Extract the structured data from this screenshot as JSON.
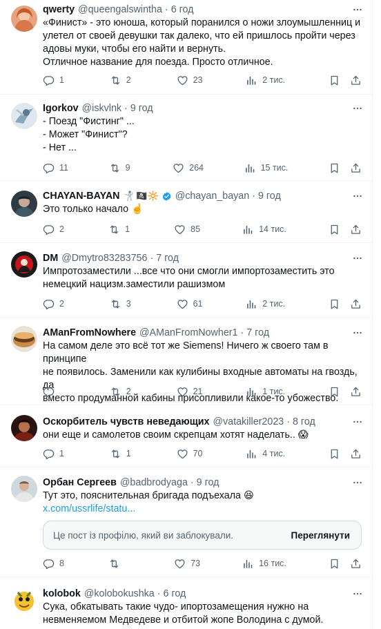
{
  "posts": [
    {
      "name": "qwerty",
      "handle": "@queengalswintha",
      "time": "6 год",
      "text": "«Финист» - это юноша, который поранился о ножи злоумышленниц и\nулетел от своей девушки так далеко, что ей пришлось пройти через\nадовы муки, чтобы его найти и вернуть.\nОтличное название для поезда. Просто отличное.",
      "replies": "1",
      "reposts": "2",
      "likes": "23",
      "views": "2 тис."
    },
    {
      "name": "Igorkov",
      "handle": "@iskvlnk",
      "time": "9 год",
      "text": "- Поезд \"Фистинг\" ...\n- Может \"Финист\"?\n- Нет ...",
      "replies": "11",
      "reposts": "9",
      "likes": "264",
      "views": "15 тис."
    },
    {
      "name": "CHAYAN-BAYAN",
      "badges": "🤺 🏴‍☠️🔆",
      "handle": "@chayan_bayan",
      "time": "9 год",
      "text": "Это только начало ☝️",
      "replies": "2",
      "reposts": "1",
      "likes": "85",
      "views": "14 тис."
    },
    {
      "name": "DM",
      "handle": "@Dmytro83283756",
      "time": "7 год",
      "text": "Импротозаместили ...все что они смогли импортозаместить это\nнемецкий нацизм.заместили рашизмом",
      "replies": "2",
      "reposts": "3",
      "likes": "61",
      "views": "2 тис."
    },
    {
      "name": "AManFromNowhere",
      "handle": "@AManFromNowher1",
      "time": "7 год",
      "text": "На самом деле это всё тот же Siemens! Ничего ж своего там в принципе\nне появилось. Заменили как кулибины входные автоматы на гвоздь, да\nвместо продуманной кабины присопливили какое-то убожество.",
      "replies": "",
      "reposts": "2",
      "likes": "21",
      "views": "1 тис."
    },
    {
      "name": "Оскорбитель чувств неведающих",
      "handle": "@vatakiller2023",
      "time": "8 год",
      "text": "они еще и самолетов своим скрепцам хотят наделать.. 😱",
      "replies": "1",
      "reposts": "1",
      "likes": "70",
      "views": "4 тис."
    },
    {
      "name": "Орбан Сергеев",
      "handle": "@badbrodyaga",
      "time": "9 год",
      "text": "Тут это, пояснительная бригада подъехала 😆",
      "link": "x.com/ussrlife/statu...",
      "quote_text": "Це пост із профілю, який ви заблокували.",
      "quote_button": "Переглянути",
      "replies": "8",
      "reposts": "",
      "likes": "73",
      "views": "16 тис."
    },
    {
      "name": "kolobok",
      "handle": "@kolobokushka",
      "time": "6 год",
      "text": "Сука, обкатывать такие чудо- ипортозамещения нужно на\nневменяемом Медведеве и отбитой жопе Володина с думой."
    }
  ],
  "icons": {
    "reply": "reply-icon",
    "repost": "repost-icon",
    "like": "like-icon",
    "views": "views-icon",
    "bookmark": "bookmark-icon",
    "share": "share-icon",
    "more": "more-icon",
    "verified": "verified-badge-icon"
  },
  "colors": {
    "link": "#1d9bf0",
    "muted": "#536471",
    "verified": "#1d9bf0"
  }
}
